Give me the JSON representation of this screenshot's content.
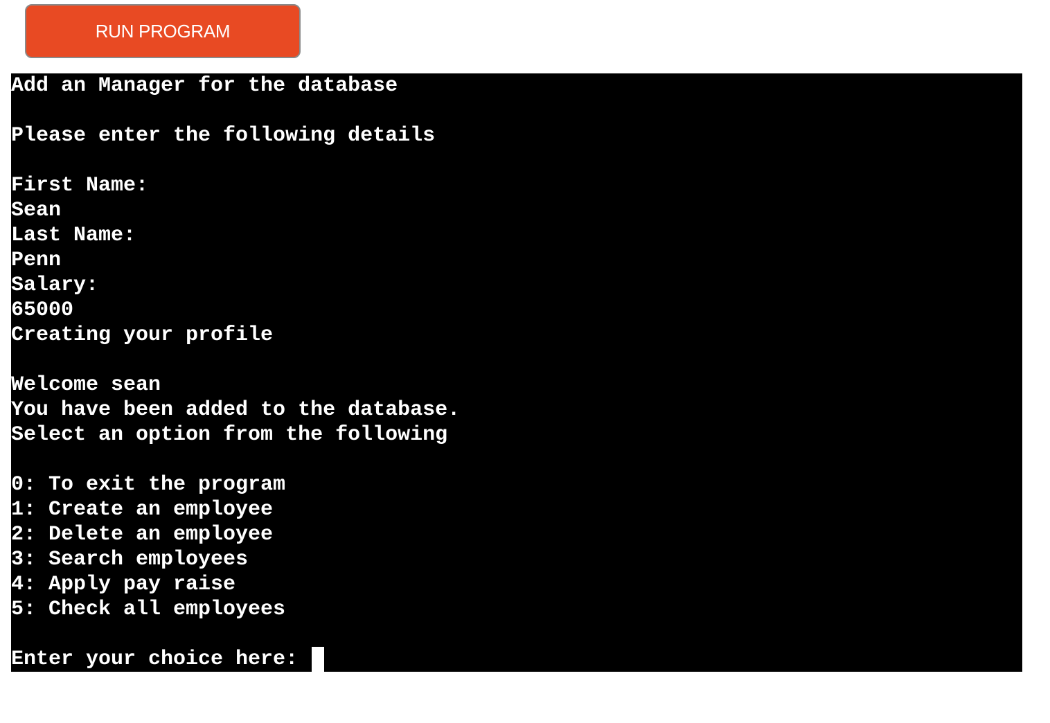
{
  "toolbar": {
    "run_label": "RUN PROGRAM"
  },
  "terminal": {
    "lines": [
      "Add an Manager for the database",
      "",
      "Please enter the following details",
      "",
      "First Name:",
      "Sean",
      "Last Name:",
      "Penn",
      "Salary:",
      "65000",
      "Creating your profile",
      "",
      "Welcome sean",
      "You have been added to the database.",
      "Select an option from the following",
      "",
      "0: To exit the program",
      "1: Create an employee",
      "2: Delete an employee",
      "3: Search employees",
      "4: Apply pay raise",
      "5: Check all employees",
      ""
    ],
    "prompt": "Enter your choice here: "
  },
  "colors": {
    "button_bg": "#e84a23",
    "terminal_bg": "#000000",
    "terminal_fg": "#ffffff"
  }
}
